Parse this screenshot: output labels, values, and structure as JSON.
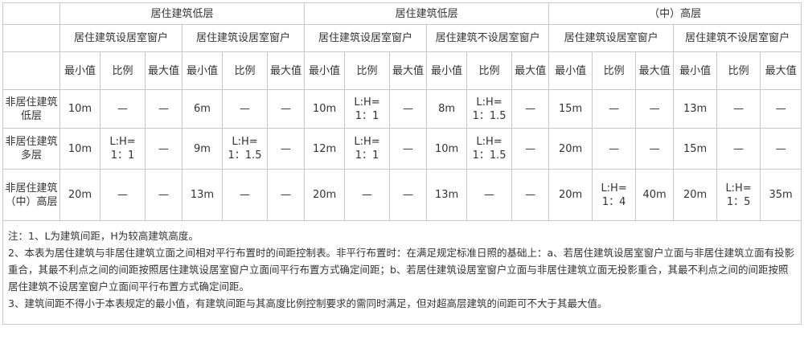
{
  "table": {
    "group_headers": [
      "居住建筑低层",
      "居住建筑低层",
      "（中）高层"
    ],
    "sub_headers": [
      "居住建筑设居室窗户",
      "居住建筑设居室窗户",
      "居住建筑设居室窗户",
      "居住建筑不设居室窗户",
      "居住建筑设居室窗户",
      "居住建筑不设居室窗户"
    ],
    "col_headers": [
      "最小值",
      "比例",
      "最大值",
      "最小值",
      "比例",
      "最大值",
      "最小值",
      "比例",
      "最大值",
      "最小值",
      "比例",
      "最大值",
      "最小值",
      "比例",
      "最大值",
      "最小值",
      "比例",
      "最大值"
    ],
    "rows": [
      {
        "label": "非居住建筑低层",
        "cells": [
          "10m",
          "—",
          "—",
          "6m",
          "—",
          "—",
          "10m",
          "L:H=|1：1",
          "—",
          "8m",
          "L:H=|1：1.5",
          "—",
          "15m",
          "—",
          "—",
          "13m",
          "—",
          "—"
        ]
      },
      {
        "label": "非居住建筑多层",
        "cells": [
          "10m",
          "L:H=|1：1",
          "—",
          "9m",
          "L:H=|1：1.5",
          "—",
          "12m",
          "L:H=|1：1",
          "—",
          "10m",
          "L:H=|1：1.5",
          "—",
          "20m",
          "—",
          "—",
          "15m",
          "—",
          "—"
        ]
      },
      {
        "label": "非居住建筑（中）高层",
        "cells": [
          "20m",
          "—",
          "—",
          "13m",
          "—",
          "—",
          "20m",
          "—",
          "—",
          "13m",
          "—",
          "—",
          "20m",
          "L:H=|1：4",
          "40m",
          "20m",
          "L:H=|1：5",
          "35m"
        ]
      }
    ],
    "notes": [
      "注：1、L为建筑间距，H为较高建筑高度。",
      "2、本表为居住建筑与非居住建筑立面之间相对平行布置时的间距控制表。非平行布置时：在满足规定标准日照的基础上：a、若居住建筑设居室窗户立面与非居住建筑立面有投影重合，其最不利点之间的间距按照居住建筑设居室窗户立面间平行布置方式确定间距；b、若居住建筑设居室窗户立面与非居住建筑立面无投影重合，其最不利点之间的间距按照居住建筑不设居室窗户立面间平行布置方式确定间距。",
      "3、建筑间距不得小于本表规定的最小值，有建筑间距与其高度比例控制要求的需同时满足，但对超高层建筑的间距可不大于其最大值。"
    ]
  }
}
